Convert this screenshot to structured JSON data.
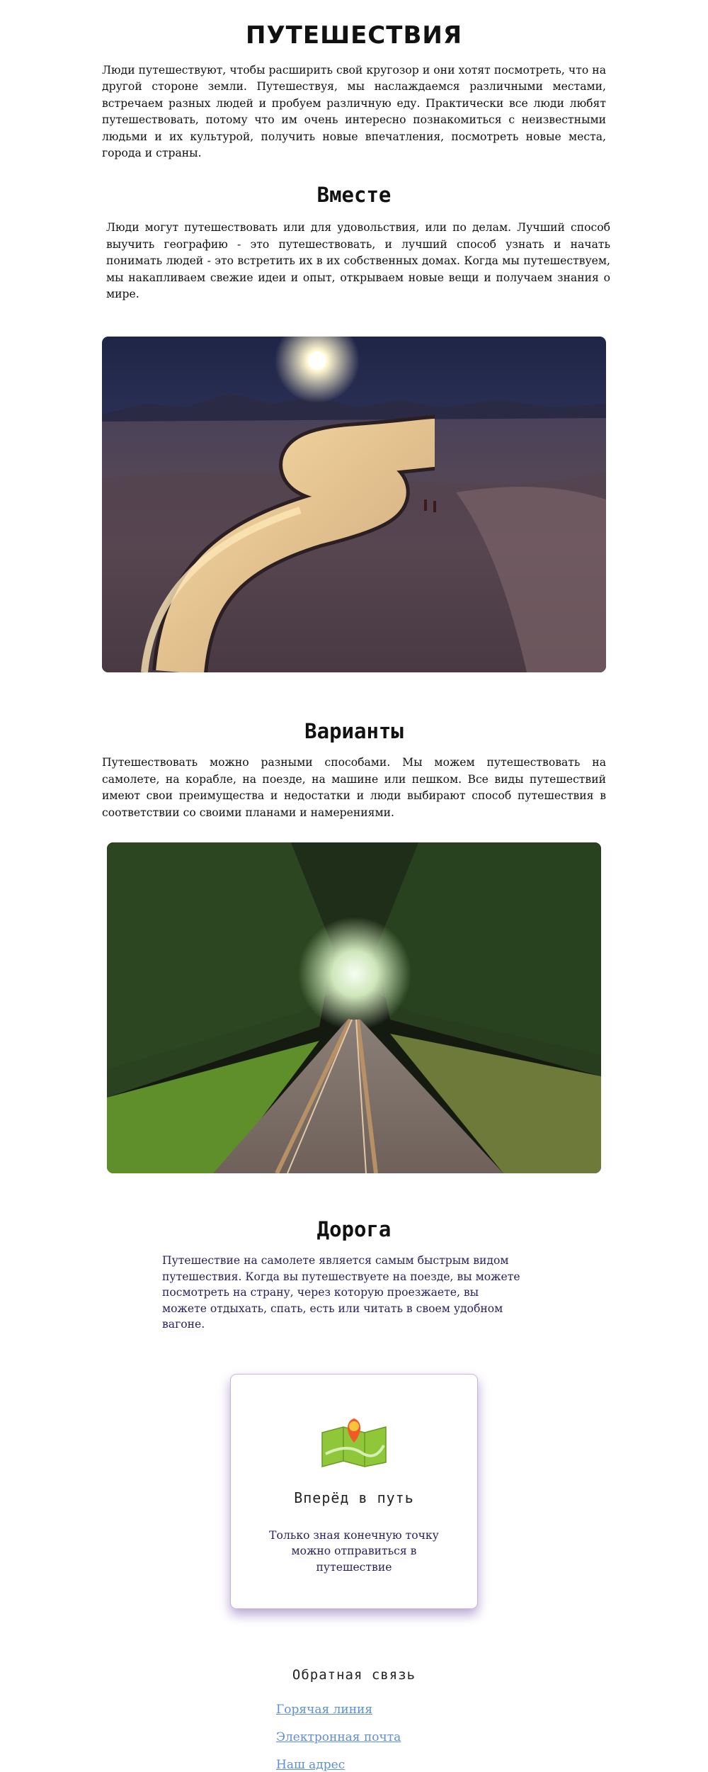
{
  "header": {
    "title": "ПУТЕШЕСТВИЯ",
    "intro": "Люди путешествуют, чтобы расширить свой кругозор и они хотят посмотреть, что на другой стороне земли. Путешествуя, мы наслаждаемся различными местами, встречаем разных людей и пробуем различную еду. Практически все люди любят путешествовать, потому что им очень интересно познакомиться с неизвестными людьми и их культурой, получить новые впечатления, посмотреть новые места, города и страны."
  },
  "sections": [
    {
      "heading": "Вместе",
      "text": "Люди могут путешествовать или для удовольствия, или по делам. Лучший способ выучить географию - это путешествовать, и лучший способ узнать и начать понимать людей - это встретить их в их собственных домах. Когда мы путешествуем, мы накапливаем свежие идеи и опыт, открываем новые вещи и получаем знания о мире.",
      "image": "winding-road-photo"
    },
    {
      "heading": "Варианты",
      "text": "Путешествовать можно разными способами. Мы можем путешествовать на самолете, на корабле, на поезде, на машине или пешком. Все виды путешествий имеют свои преимущества и недостатки и люди выбирают способ путешествия в соответствии со своими планами и намерениями.",
      "image": "railway-forest-tunnel-photo"
    },
    {
      "heading": "Дорога",
      "text": "Путешествие на самолете является самым быстрым видом путешествия. Когда вы путешествуете на поезде, вы можете посмотреть на страну, через которую проезжаете, вы можете отдыхать, спать, есть или читать в своем удобном вагоне."
    }
  ],
  "card": {
    "icon": "map-pin-icon",
    "title": "Вперёд в путь",
    "text": "Только зная конечную точку можно отправиться в путешествие"
  },
  "footer": {
    "title": "Обратная связь",
    "links": [
      "Горячая линия",
      "Электронная почта",
      "Наш адрес"
    ]
  },
  "colors": {
    "link": "#5f8fd6",
    "accent_text": "#2b1e5c",
    "card_shadow": "#9a7cc4"
  }
}
